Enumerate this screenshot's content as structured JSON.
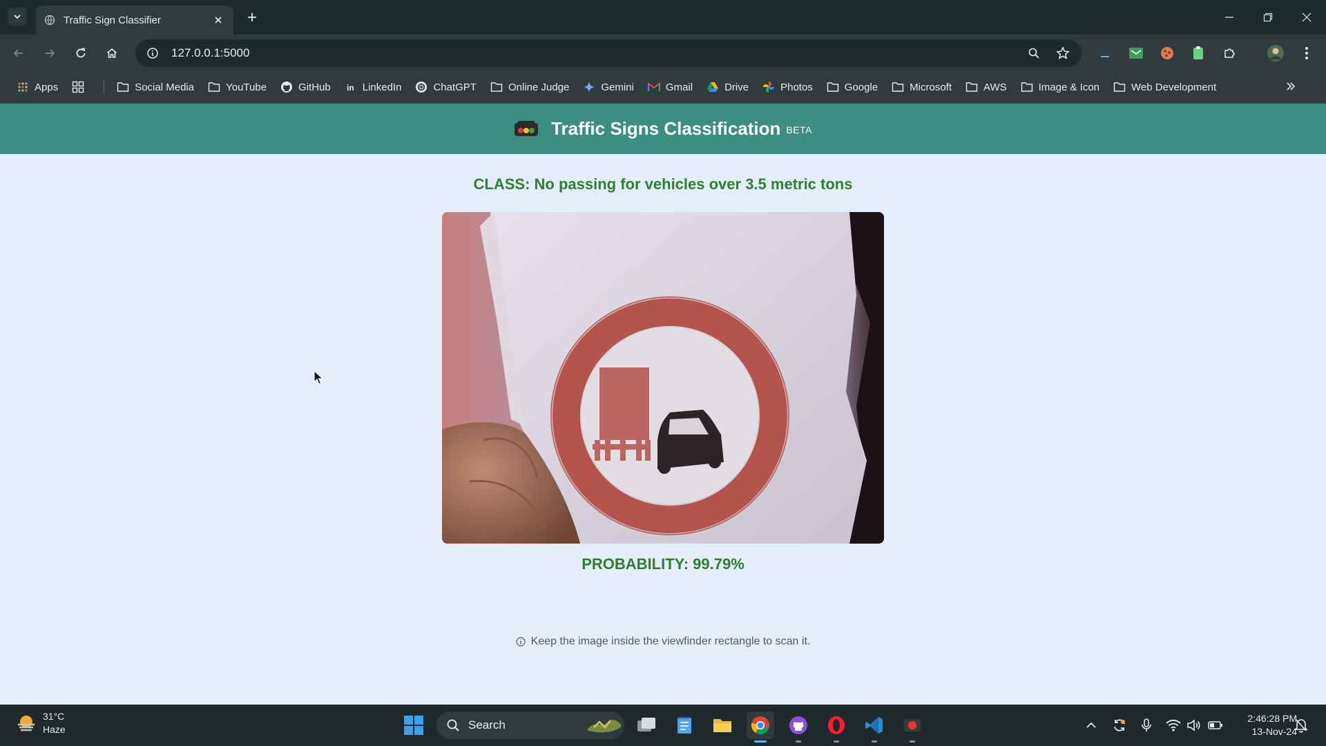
{
  "browser": {
    "tab_title": "Traffic Sign Classifier",
    "url": "127.0.0.1:5000"
  },
  "bookmarks": [
    {
      "label": "Apps",
      "icon": "apps-grid-icon"
    },
    {
      "label": "Social Media",
      "icon": "folder-icon"
    },
    {
      "label": "YouTube",
      "icon": "folder-icon"
    },
    {
      "label": "GitHub",
      "icon": "github-icon"
    },
    {
      "label": "LinkedIn",
      "icon": "linkedin-icon"
    },
    {
      "label": "ChatGPT",
      "icon": "chatgpt-icon"
    },
    {
      "label": "Online Judge",
      "icon": "folder-icon"
    },
    {
      "label": "Gemini",
      "icon": "gemini-icon"
    },
    {
      "label": "Gmail",
      "icon": "gmail-icon"
    },
    {
      "label": "Drive",
      "icon": "drive-icon"
    },
    {
      "label": "Photos",
      "icon": "photos-icon"
    },
    {
      "label": "Google",
      "icon": "folder-icon"
    },
    {
      "label": "Microsoft",
      "icon": "folder-icon"
    },
    {
      "label": "AWS",
      "icon": "folder-icon"
    },
    {
      "label": "Image & Icon",
      "icon": "folder-icon"
    },
    {
      "label": "Web Development",
      "icon": "folder-icon"
    }
  ],
  "app": {
    "title": "Traffic Signs Classification",
    "badge": "BETA",
    "class_result": "CLASS: No passing for vehicles over 3.5 metric tons",
    "probability": "PROBABILITY: 99.79%",
    "hint": "Keep the image inside the viewfinder rectangle to scan it.",
    "header_color": "#3a8f80",
    "result_color": "#2f7f2f"
  },
  "taskbar": {
    "weather_temp": "31°C",
    "weather_desc": "Haze",
    "search_label": "Search",
    "time": "2:46:28 PM",
    "date": "13-Nov-24"
  }
}
